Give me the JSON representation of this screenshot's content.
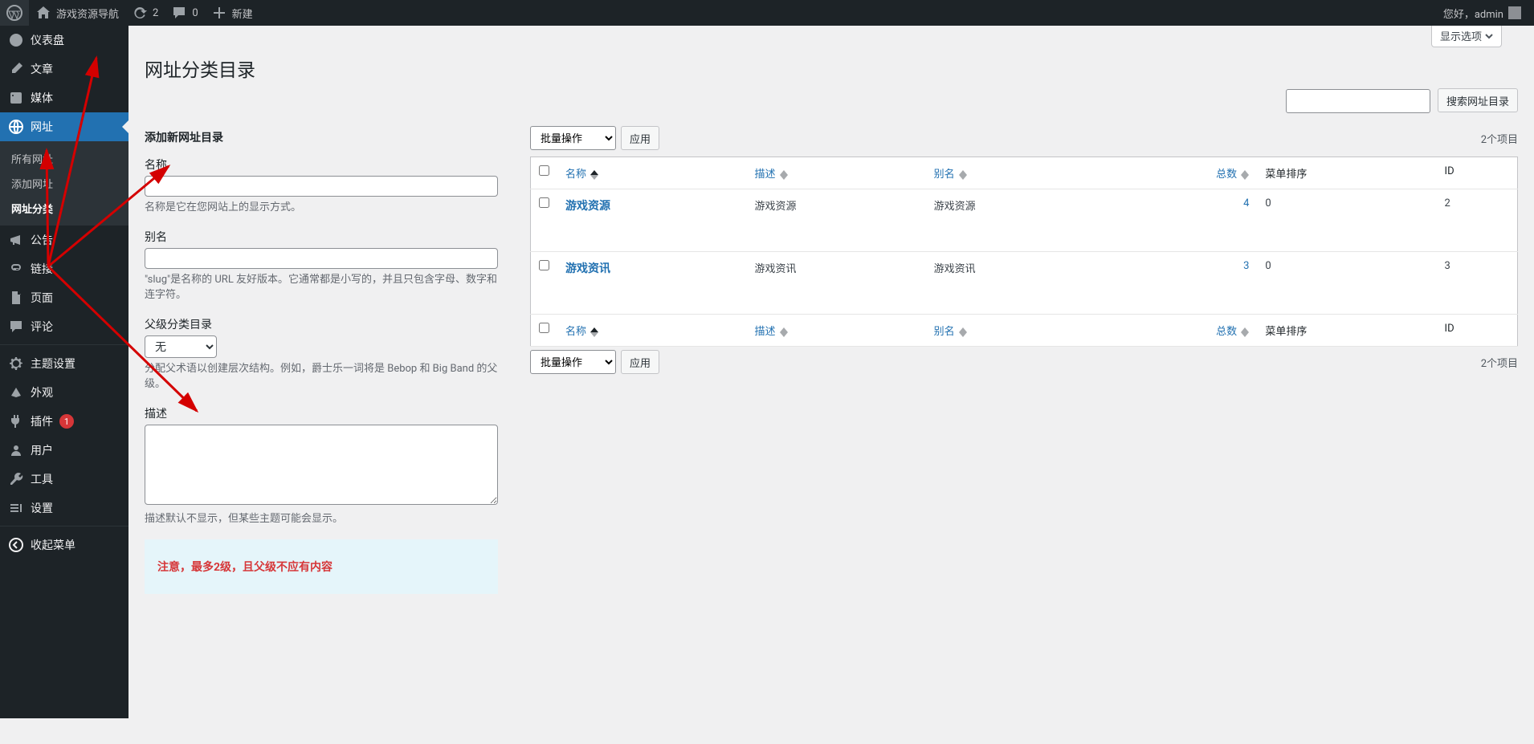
{
  "adminbar": {
    "site_name": "游戏资源导航",
    "refresh_count": "2",
    "comments_count": "0",
    "new_label": "新建",
    "greeting": "您好，admin"
  },
  "sidebar": {
    "items": [
      {
        "icon": "dashboard",
        "label": "仪表盘"
      },
      {
        "icon": "posts",
        "label": "文章"
      },
      {
        "icon": "media",
        "label": "媒体"
      },
      {
        "icon": "site",
        "label": "网址",
        "current": true,
        "submenu": [
          {
            "label": "所有网址"
          },
          {
            "label": "添加网址"
          },
          {
            "label": "网址分类",
            "current": true
          }
        ]
      },
      {
        "icon": "megaphone",
        "label": "公告"
      },
      {
        "icon": "links",
        "label": "链接"
      },
      {
        "icon": "pages",
        "label": "页面"
      },
      {
        "icon": "comments",
        "label": "评论"
      },
      {
        "sep": true
      },
      {
        "icon": "settings",
        "label": "主题设置"
      },
      {
        "icon": "appearance",
        "label": "外观"
      },
      {
        "icon": "plugins",
        "label": "插件",
        "badge": "1"
      },
      {
        "icon": "users",
        "label": "用户"
      },
      {
        "icon": "tools",
        "label": "工具"
      },
      {
        "icon": "settings2",
        "label": "设置"
      },
      {
        "sep": true
      },
      {
        "icon": "collapse",
        "label": "收起菜单"
      }
    ]
  },
  "screen_options": "显示选项",
  "page_title": "网址分类目录",
  "form": {
    "heading": "添加新网址目录",
    "name_label": "名称",
    "name_desc": "名称是它在您网站上的显示方式。",
    "slug_label": "别名",
    "slug_desc": "\"slug\"是名称的 URL 友好版本。它通常都是小写的，并且只包含字母、数字和连字符。",
    "parent_label": "父级分类目录",
    "parent_option": "无",
    "parent_desc": "分配父术语以创建层次结构。例如，爵士乐一词将是 Bebop 和 Big Band 的父级。",
    "desc_label": "描述",
    "desc_desc": "描述默认不显示，但某些主题可能会显示。",
    "notice": "注意，最多2级，且父级不应有内容"
  },
  "table": {
    "bulk_label": "批量操作",
    "apply_label": "应用",
    "items_count": "2个项目",
    "search_button": "搜索网址目录",
    "cols": {
      "name": "名称",
      "desc": "描述",
      "slug": "别名",
      "count": "总数",
      "order": "菜单排序",
      "id": "ID"
    },
    "rows": [
      {
        "name": "游戏资源",
        "desc": "游戏资源",
        "slug": "游戏资源",
        "count": "4",
        "order": "0",
        "id": "2"
      },
      {
        "name": "游戏资讯",
        "desc": "游戏资讯",
        "slug": "游戏资讯",
        "count": "3",
        "order": "0",
        "id": "3"
      }
    ]
  }
}
